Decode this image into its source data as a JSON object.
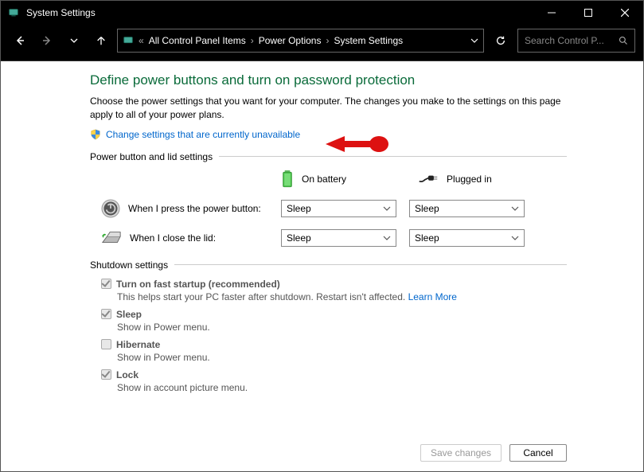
{
  "window": {
    "title": "System Settings"
  },
  "nav": {
    "crumb1": "All Control Panel Items",
    "crumb2": "Power Options",
    "crumb3": "System Settings",
    "search_placeholder": "Search Control P..."
  },
  "page": {
    "heading": "Define power buttons and turn on password protection",
    "description": "Choose the power settings that you want for your computer. The changes you make to the settings on this page apply to all of your power plans.",
    "change_link": "Change settings that are currently unavailable"
  },
  "group1": {
    "title": "Power button and lid settings",
    "col_battery": "On battery",
    "col_plugged": "Plugged in",
    "row_power_label": "When I press the power button:",
    "row_lid_label": "When I close the lid:",
    "power_battery": "Sleep",
    "power_plugged": "Sleep",
    "lid_battery": "Sleep",
    "lid_plugged": "Sleep"
  },
  "group2": {
    "title": "Shutdown settings",
    "items": [
      {
        "label": "Turn on fast startup (recommended)",
        "sub": "This helps start your PC faster after shutdown. Restart isn't affected. ",
        "learn": "Learn More",
        "checked": true
      },
      {
        "label": "Sleep",
        "sub": "Show in Power menu.",
        "checked": true
      },
      {
        "label": "Hibernate",
        "sub": "Show in Power menu.",
        "checked": false
      },
      {
        "label": "Lock",
        "sub": "Show in account picture menu.",
        "checked": true
      }
    ]
  },
  "footer": {
    "save": "Save changes",
    "cancel": "Cancel"
  }
}
